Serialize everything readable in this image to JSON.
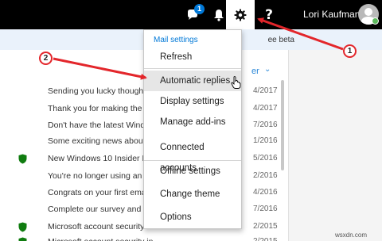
{
  "topbar": {
    "notification_count": "1",
    "help_label": "?",
    "user_name": "Lori Kaufman",
    "icons": [
      "skype-icon",
      "bell-icon",
      "gear-icon",
      "help-icon",
      "avatar-icon"
    ]
  },
  "notice": {
    "text": "ee beta"
  },
  "list": {
    "sort_label": "er",
    "items": [
      {
        "subject": "Sending you lucky thoughts",
        "date": "4/2017",
        "shield": false
      },
      {
        "subject": "Thank you for making the fi",
        "date": "4/2017",
        "shield": false
      },
      {
        "subject": "Don't have the latest Window",
        "date": "7/2016",
        "shield": false
      },
      {
        "subject": "Some exciting news about W",
        "date": "1/2016",
        "shield": false
      },
      {
        "subject": "New Windows 10 Insider Pre",
        "date": "5/2016",
        "shield": true
      },
      {
        "subject": "You're no longer using an C",
        "date": "2/2016",
        "shield": false
      },
      {
        "subject": "Congrats on your first email",
        "date": "4/2016",
        "shield": false
      },
      {
        "subject": "Complete our survey and ge",
        "date": "7/2016",
        "shield": false
      },
      {
        "subject": "Microsoft account security in",
        "date": "2/2015",
        "shield": true
      },
      {
        "subject": "Microsoft account security in",
        "date": "2/2015",
        "shield": true
      }
    ]
  },
  "menu": {
    "header": "Mail settings",
    "items": [
      "Refresh",
      "Automatic replies",
      "Display settings",
      "Manage add-ins",
      "Connected accounts",
      "Offline settings",
      "Change theme",
      "Options"
    ],
    "highlighted": "Automatic replies"
  },
  "annotations": {
    "callout_1": "1",
    "callout_2": "2"
  },
  "watermark": "wsxdn.com",
  "colors": {
    "topbar": "#000000",
    "accent": "#0078d7",
    "annotation": "#e3262b",
    "shield": "#107c10",
    "presence": "#5cb85c"
  }
}
